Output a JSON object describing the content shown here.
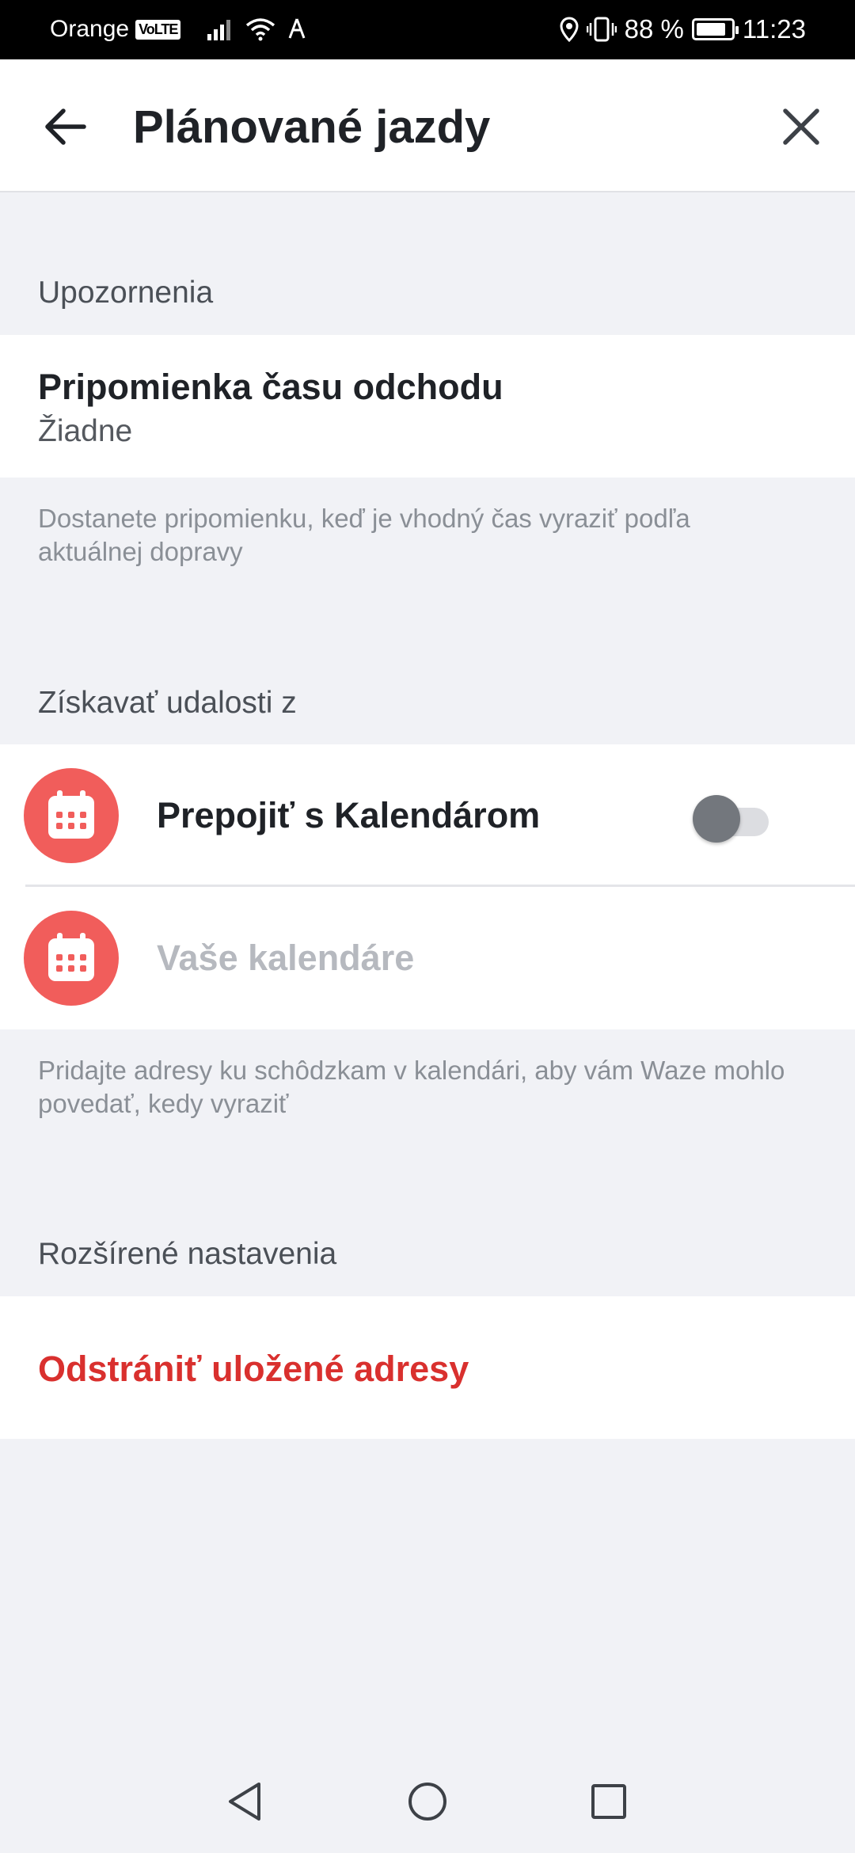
{
  "status_bar": {
    "carrier": "Orange",
    "volte": "VoLTE",
    "battery_pct": "88 %",
    "time": "11:23",
    "battery_level": 0.88
  },
  "app_bar": {
    "title": "Plánované jazdy",
    "back_icon": "arrow-left-icon",
    "close_icon": "close-icon"
  },
  "sections": {
    "notifications": {
      "header": "Upozornenia",
      "reminder_title": "Pripomienka času odchodu",
      "reminder_value": "Žiadne",
      "description": "Dostanete pripomienku, keď je vhodný čas vyraziť podľa aktuálnej dopravy"
    },
    "events": {
      "header": "Získavať udalosti z",
      "connect_label": "Prepojiť s Kalendárom",
      "connect_enabled": false,
      "calendars_label": "Vaše kalendáre",
      "description": "Pridajte adresy ku schôdzkam v kalendári, aby vám Waze mohlo povedať, kedy vyraziť"
    },
    "advanced": {
      "header": "Rozšírené nastavenia",
      "delete_label": "Odstrániť uložené adresy"
    }
  },
  "colors": {
    "accent": "#f15d5b",
    "danger": "#d9302e",
    "background": "#f1f2f6"
  }
}
